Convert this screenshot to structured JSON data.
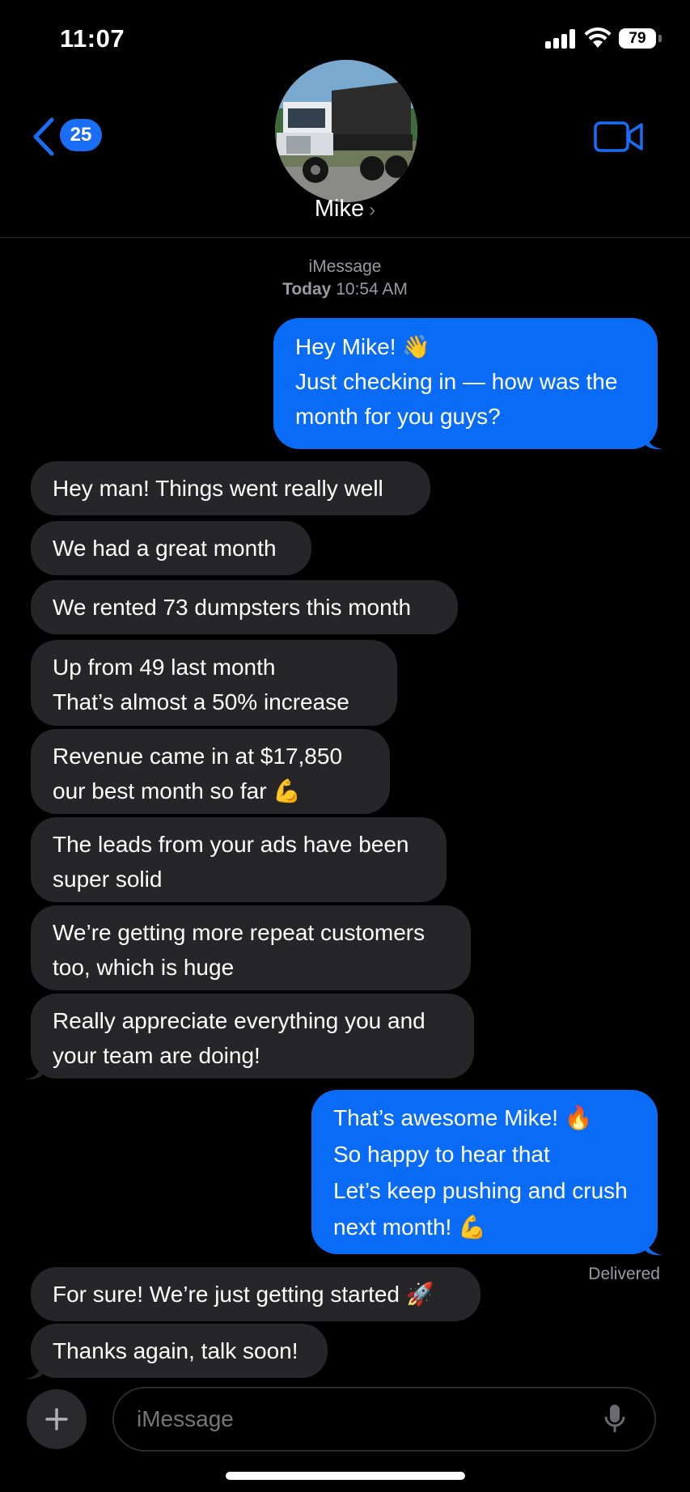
{
  "status_bar": {
    "time": "11:07",
    "battery": "79"
  },
  "header": {
    "back_count": "25",
    "contact_name": "Mike",
    "contact_chevron": "›",
    "avatar": "dump-truck-photo"
  },
  "thread": {
    "service": "iMessage",
    "day": "Today",
    "time": "10:54 AM"
  },
  "messages": [
    {
      "from": "me",
      "text": "Hey Mike! 👋\nJust checking in — how was the\nmonth for you guys?"
    },
    {
      "from": "them",
      "text": "Hey man! Things went really well"
    },
    {
      "from": "them",
      "text": "We had a great month"
    },
    {
      "from": "them",
      "text": "We rented 73 dumpsters this month"
    },
    {
      "from": "them",
      "text": "Up from 49 last month\nThat’s almost a 50% increase"
    },
    {
      "from": "them",
      "text": "Revenue came in at $17,850\nour best month so far 💪"
    },
    {
      "from": "them",
      "text": "The leads from your ads have been\nsuper solid"
    },
    {
      "from": "them",
      "text": "We’re getting more repeat customers\ntoo, which is huge"
    },
    {
      "from": "them",
      "text": "Really appreciate everything you and\nyour team are doing!"
    },
    {
      "from": "me",
      "text": "That’s awesome Mike! 🔥\nSo happy to hear that\nLet’s keep pushing and crush\nnext month! 💪"
    },
    {
      "from": "them",
      "text": "For sure! We’re just getting started 🚀"
    },
    {
      "from": "them",
      "text": "Thanks again, talk soon!"
    }
  ],
  "delivered_label": "Delivered",
  "composer": {
    "placeholder": "iMessage"
  },
  "colors": {
    "outgoing": "#0a6cf6",
    "incoming": "#262628",
    "accent": "#1a6ef5",
    "background": "#000000"
  }
}
